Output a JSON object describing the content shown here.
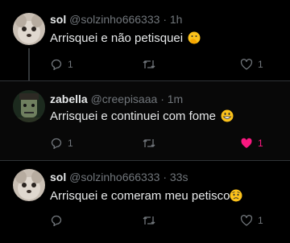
{
  "tweets": [
    {
      "display_name": "sol",
      "handle": "@solzinho666333",
      "time": "1h",
      "text": "Arrisquei e não petisquei",
      "emoji": "hand-over-mouth-emoji",
      "replies": "1",
      "likes": "1",
      "liked": false
    },
    {
      "display_name": "zabella",
      "handle": "@creepisaaa",
      "time": "1m",
      "text": "Arrisquei e continuei com fome",
      "emoji": "grinning-face-emoji",
      "replies": "1",
      "likes": "1",
      "liked": true
    },
    {
      "display_name": "sol",
      "handle": "@solzinho666333",
      "time": "33s",
      "text": "Arrisquei e comeram meu petisco",
      "emoji": "worried-face-emoji",
      "replies": "",
      "likes": "1",
      "liked": false
    }
  ],
  "separator": "·",
  "colors": {
    "background": "#000000",
    "text": "#e7e9ea",
    "muted": "#71767b",
    "like": "#f91880"
  }
}
